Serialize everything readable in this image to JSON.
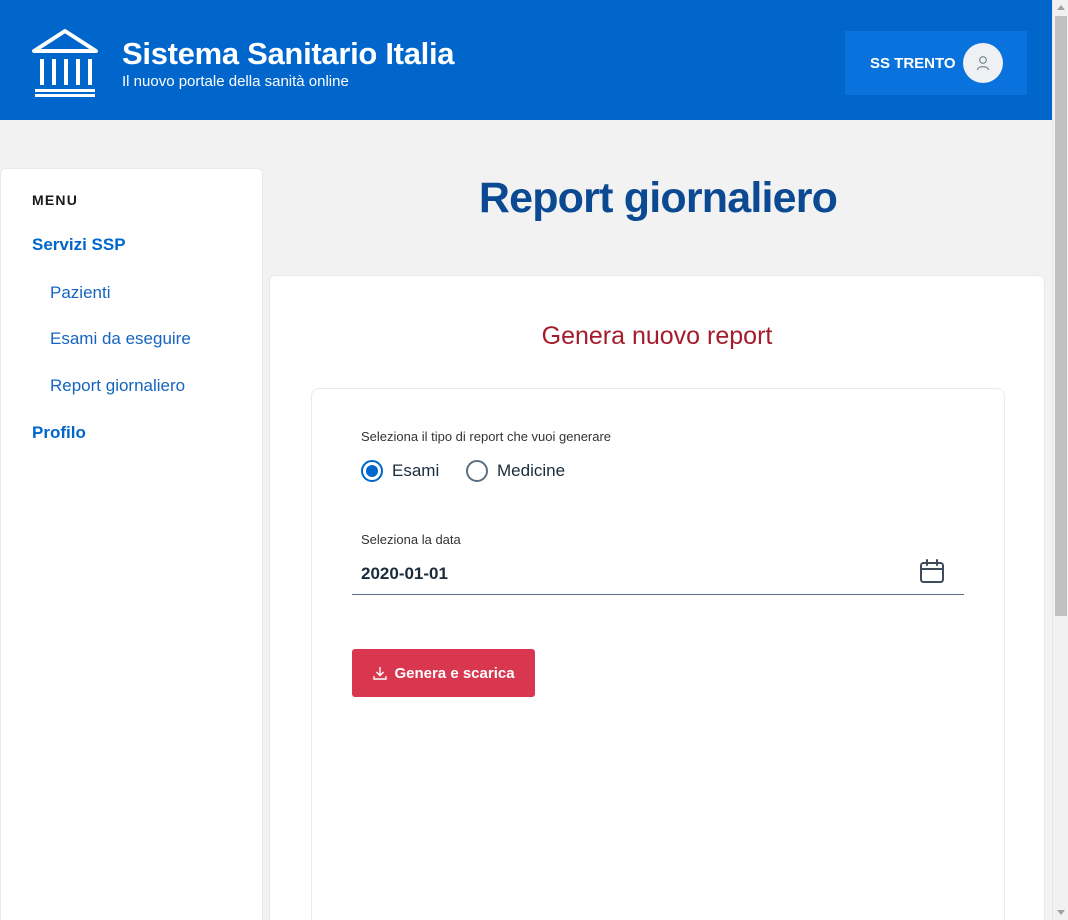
{
  "header": {
    "title": "Sistema Sanitario Italia",
    "subtitle": "Il nuovo portale della sanità online",
    "logo_icon": "institution-building-icon",
    "user_label": "SS TRENTO",
    "avatar_icon": "user-icon",
    "background_color": "#0066cc"
  },
  "sidebar": {
    "menu_title": "MENU",
    "items": [
      {
        "label": "Servizi SSP",
        "level": 1
      },
      {
        "label": "Pazienti",
        "level": 2
      },
      {
        "label": "Esami da eseguire",
        "level": 2
      },
      {
        "label": "Report giornaliero",
        "level": 2
      },
      {
        "label": "Profilo",
        "level": 1
      }
    ]
  },
  "main": {
    "page_title": "Report giornaliero",
    "card_title": "Genera nuovo report",
    "report_type": {
      "label": "Seleziona il tipo di report che vuoi generare",
      "options": [
        {
          "label": "Esami",
          "checked": true
        },
        {
          "label": "Medicine",
          "checked": false
        }
      ]
    },
    "date": {
      "label": "Seleziona la data",
      "value": "2020-01-01",
      "icon": "calendar-icon"
    },
    "submit": {
      "label": "Genera e scarica",
      "icon": "download-icon",
      "color": "#d9364f"
    }
  },
  "colors": {
    "accent": "#0066cc",
    "title": "#0b4a93",
    "card_title": "#a41c2c"
  }
}
